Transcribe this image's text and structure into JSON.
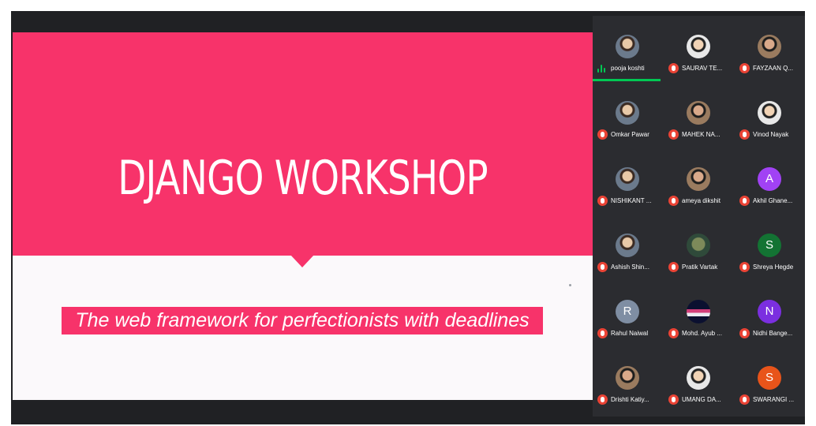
{
  "slide": {
    "title": "DJANGO WORKSHOP",
    "subtitle": "The web framework for perfectionists with deadlines",
    "colors": {
      "accent": "#f7336a",
      "background": "#fbf9fb"
    }
  },
  "participants": [
    {
      "name": "pooja koshti",
      "avatar": "photo",
      "muted": false,
      "speaking": true
    },
    {
      "name": "SAURAV TE...",
      "avatar": "photo3",
      "muted": true
    },
    {
      "name": "FAYZAAN Q...",
      "avatar": "photo2",
      "muted": true
    },
    {
      "name": "Omkar Pawar",
      "avatar": "photo",
      "muted": true
    },
    {
      "name": "MAHEK NA...",
      "avatar": "photo2",
      "muted": true
    },
    {
      "name": "Vinod Nayak",
      "avatar": "photo3",
      "muted": true
    },
    {
      "name": "NISHIKANT ...",
      "avatar": "photo",
      "muted": true
    },
    {
      "name": "ameya dikshit",
      "avatar": "photo2",
      "muted": true
    },
    {
      "name": "Akhil Ghane...",
      "avatar": "letter",
      "initial": "A",
      "color": "#a142f4",
      "muted": true
    },
    {
      "name": "Ashish Shin...",
      "avatar": "photo",
      "muted": true
    },
    {
      "name": "Pratik Vartak",
      "avatar": "photo4",
      "muted": true
    },
    {
      "name": "Shreya Hegde",
      "avatar": "letter",
      "initial": "S",
      "color": "#137333",
      "muted": true
    },
    {
      "name": "Rahul Naiwal",
      "avatar": "letter",
      "initial": "R",
      "color": "#7f8ea3",
      "muted": true
    },
    {
      "name": "Mohd. Ayub ...",
      "avatar": "photo5",
      "muted": true
    },
    {
      "name": "Nidhi Bange...",
      "avatar": "letter",
      "initial": "N",
      "color": "#7b2fe0",
      "muted": true
    },
    {
      "name": "Drishti Katiy...",
      "avatar": "photo2",
      "muted": true
    },
    {
      "name": "UMANG DA...",
      "avatar": "photo3",
      "muted": true
    },
    {
      "name": "SWARANGI ...",
      "avatar": "letter",
      "initial": "S",
      "color": "#e8541a",
      "muted": true
    }
  ]
}
